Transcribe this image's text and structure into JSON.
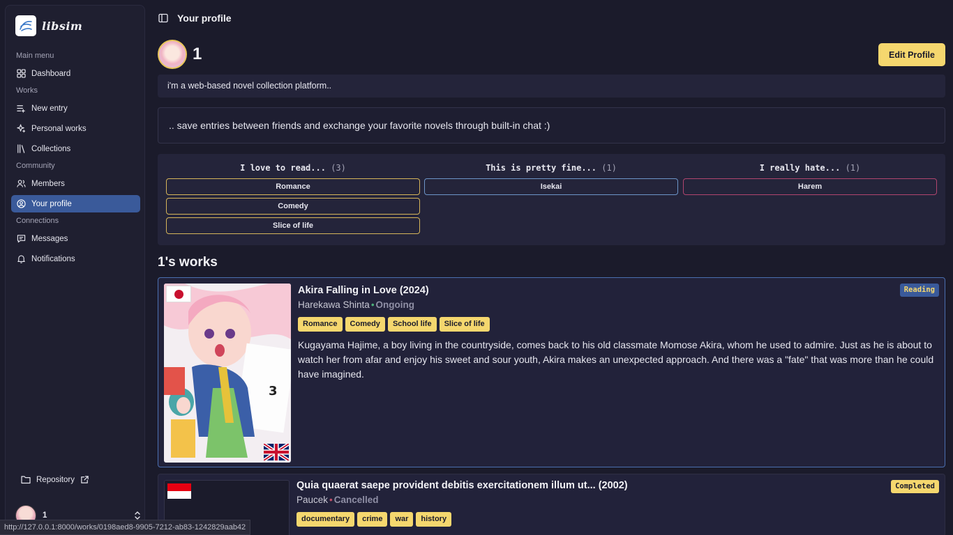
{
  "app": {
    "name": "libsim"
  },
  "sidebar": {
    "groups": [
      {
        "label": "Main menu",
        "items": [
          {
            "label": "Dashboard",
            "icon": "grid-icon"
          }
        ]
      },
      {
        "label": "Works",
        "items": [
          {
            "label": "New entry",
            "icon": "list-plus-icon"
          },
          {
            "label": "Personal works",
            "icon": "sparkles-icon"
          },
          {
            "label": "Collections",
            "icon": "library-icon"
          }
        ]
      },
      {
        "label": "Community",
        "items": [
          {
            "label": "Members",
            "icon": "users-icon"
          },
          {
            "label": "Your profile",
            "icon": "user-circle-icon",
            "active": true
          }
        ]
      },
      {
        "label": "Connections",
        "items": [
          {
            "label": "Messages",
            "icon": "message-icon"
          },
          {
            "label": "Notifications",
            "icon": "bell-icon"
          }
        ]
      }
    ],
    "repository": "Repository",
    "user": {
      "name": "1"
    }
  },
  "header": {
    "title": "Your profile"
  },
  "profile": {
    "name": "1",
    "edit_label": "Edit Profile",
    "bio_line1": "i'm a web-based novel collection platform..",
    "bio_line2": ".. save entries between friends and exchange your favorite novels through built-in chat :)"
  },
  "preferences": {
    "love": {
      "label": "I love to read...",
      "count": "(3)",
      "tags": [
        "Romance",
        "Comedy",
        "Slice of life"
      ]
    },
    "fine": {
      "label": "This is pretty fine...",
      "count": "(1)",
      "tags": [
        "Isekai"
      ]
    },
    "hate": {
      "label": "I really hate...",
      "count": "(1)",
      "tags": [
        "Harem"
      ]
    }
  },
  "works_title": "1's works",
  "works": [
    {
      "title": "Akira Falling in Love (2024)",
      "author": "Harekawa Shinta",
      "status": "Ongoing",
      "badge": "Reading",
      "tags": [
        "Romance",
        "Comedy",
        "School life",
        "Slice of life"
      ],
      "synopsis": "Kugayama Hajime, a boy living in the countryside, comes back to his old classmate Momose Akira, whom he used to admire. Just as he is about to watch her from afar and enjoy his sweet and sour youth, Akira makes an unexpected approach. And there was a \"fate\" that was more than he could have imagined."
    },
    {
      "title": "Quia quaerat saepe provident debitis exercitationem illum ut... (2002)",
      "author": "Paucek",
      "status": "Cancelled",
      "badge": "Completed",
      "tags": [
        "documentary",
        "crime",
        "war",
        "history"
      ]
    }
  ],
  "statusbar": {
    "url": "http://127.0.0.1:8000/works/0198aed8-9905-7212-ab83-1242829aab42"
  },
  "colors": {
    "accent": "#f5d76e",
    "active": "#3a5a9a",
    "background": "#1b1b2b"
  }
}
